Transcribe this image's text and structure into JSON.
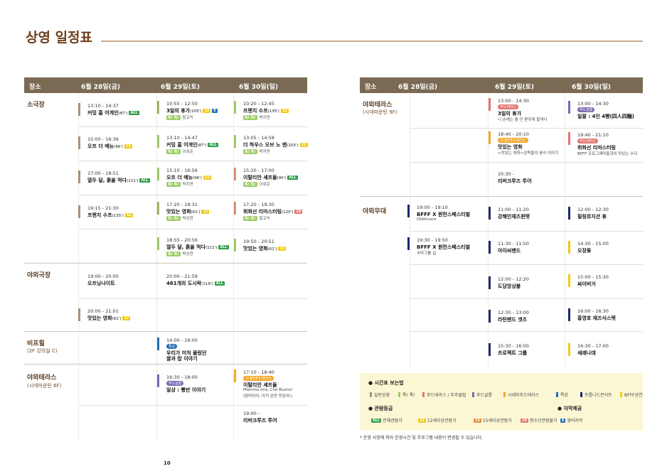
{
  "page": {
    "title": "상영 일정표",
    "number": "10",
    "note": "* 운영 사정에 따라 운영시간 및 프로그램 내용이 변경될 수 있습니다."
  },
  "colors": {
    "header": "#7a6a54",
    "general": "#a8927a",
    "talk": "#9ccc65",
    "food": "#e57373",
    "food_salon": "#7b68b3",
    "cinema_food": "#f5a623",
    "special": "#1e6fb5",
    "frontier": "#1a2a6b",
    "bfff": "#f2c812"
  },
  "left": {
    "headers": [
      "장소",
      "6월 28일(금)",
      "6월 29일(토)",
      "6월 30일(일)"
    ],
    "venues": [
      {
        "name": "소극장",
        "sub": ""
      },
      {
        "name": "야외극장",
        "sub": ""
      },
      {
        "name": "비프힐",
        "sub": "(2F 강의실 C)"
      },
      {
        "name": "야외테라스",
        "sub": "(시네마운틴 6F)"
      }
    ],
    "events": [
      {
        "time": "13:10 - 14:37",
        "name": "커밍 홈 어게인",
        "dur": "(87')",
        "rate": "ALL",
        "rc": "#2e9e48",
        "people": "",
        "bar": "#a8927a"
      },
      {
        "time": "15:00 - 16:36",
        "name": "오프 더 메뉴",
        "dur": "(96')",
        "rate": "12",
        "rc": "#f2c812",
        "people": "",
        "bar": "#a8927a"
      },
      {
        "time": "17:00 - 18:51",
        "name": "열두 달, 흙을 먹다",
        "dur": "(111')",
        "rate": "ALL",
        "rc": "#2e9e48",
        "people": "",
        "bar": "#a8927a"
      },
      {
        "time": "19:15 - 21:30",
        "name": "프렌치 수프",
        "dur": "(135')",
        "rate": "12",
        "rc": "#f2c812",
        "people": "",
        "bar": "#a8927a"
      },
      {
        "time": "10:55 - 12:50",
        "name": "3일의 휴가",
        "dur": "(105')",
        "rate": "12",
        "rc": "#f2c812",
        "rate2": "E",
        "people": "황교익",
        "bar": "split"
      },
      {
        "time": "13:10 - 14:47",
        "name": "커밍 홈 어게인",
        "dur": "(87')",
        "rate": "ALL",
        "rc": "#2e9e48",
        "people": "이호준",
        "bar": "#9ccc65"
      },
      {
        "time": "15:10 - 16:56",
        "name": "오프 더 메뉴",
        "dur": "(96')",
        "rate": "12",
        "rc": "#f2c812",
        "people": "박지연",
        "bar": "#9ccc65"
      },
      {
        "time": "17:20 - 18:31",
        "name": "맛있는 영화",
        "dur": "(61')",
        "rate": "12",
        "rc": "#f2c812",
        "people": "박상현",
        "bar": "split"
      },
      {
        "time": "18:55 - 20:56",
        "name": "열두 달, 흙을 먹다",
        "dur": "(111')",
        "rate": "ALL",
        "rc": "#2e9e48",
        "people": "박상현",
        "bar": "#9ccc65"
      },
      {
        "time": "10:20 - 12:45",
        "name": "프렌치 수프",
        "dur": "(135')",
        "rate": "12",
        "rc": "#f2c812",
        "people": "박지연",
        "bar": "#9ccc65"
      },
      {
        "time": "13:05 - 14:58",
        "name": "더 하우스 오브 노 맨",
        "dur": "(103')",
        "rate": "12",
        "rc": "#f2c812",
        "people": "박지연",
        "bar": "#9ccc65"
      },
      {
        "time": "15:20 - 17:00",
        "name": "이탈리안 셰프들",
        "dur": "(90')",
        "rate": "ALL",
        "rc": "#2e9e48",
        "people": "이호준",
        "bar": "split"
      },
      {
        "time": "17:20 - 19:30",
        "name": "취화선 리마스터링",
        "dur": "(120')",
        "rate": "18",
        "rc": "#e57373",
        "people": "황교익",
        "bar": "split"
      },
      {
        "time": "19:50 - 20:51",
        "name": "맛있는 영화",
        "dur": "(61')",
        "rate": "12",
        "rc": "#f2c812",
        "people": "",
        "bar": "#9ccc65"
      },
      {
        "time": "19:00 - 20:00",
        "name": "오프닝나이트",
        "dur": "",
        "rate": "",
        "people": "",
        "bar": ""
      },
      {
        "time": "20:00 - 21:01",
        "name": "맛있는 영화",
        "dur": "(61')",
        "rate": "12",
        "rc": "#f2c812",
        "people": "",
        "bar": "#a8927a"
      },
      {
        "time": "20:00 - 21:59",
        "name": "461개의 도시락",
        "dur": "(119')",
        "rate": "ALL",
        "rc": "#2e9e48",
        "people": "",
        "bar": ""
      },
      {
        "time": "14:00 - 16:00",
        "name": "우리가 미처 몰랐던",
        "name2": "쌀과 밥 이야기",
        "tag": "특강",
        "tc": "#1e6fb5",
        "bar": "#1e6fb5"
      },
      {
        "time": "16:30 - 18:00",
        "name": "일상 : 빵반 이야기",
        "tag": "푸드살롱",
        "tc": "#7b68b3",
        "bar": "#7b68b3"
      },
      {
        "time": "17:10 - 18:40",
        "name": "이탈리안 셰프들",
        "d1": "Mamma mia, Che Buono!",
        "d2": "(맘마미아, 이거 완전 맛있어!)",
        "tag": "시네마푸드테라스",
        "tc": "#f5a623",
        "bar": "#f5a623"
      },
      {
        "time": "19:00 -",
        "name": "리버크루즈 투어",
        "bar": ""
      }
    ],
    "talk_label": "톡! 톡!"
  },
  "right": {
    "headers": [
      "장소",
      "6월 28일(금)",
      "6월 29일(토)",
      "6월 30일(일)"
    ],
    "venues": [
      {
        "name": "야외테라스",
        "sub": "(시네마운틴 9F)"
      },
      {
        "name": "야외무대",
        "sub": ""
      }
    ],
    "terrace": [
      {
        "time": "13:00 - 14:30",
        "tag": "푸드테라스",
        "tc": "#e57373",
        "name": "3일의 휴가",
        "d": "니 손에는 뭘 안 묻히게 할꺼다",
        "bar": "#e57373"
      },
      {
        "time": "18:40 - 20:10",
        "tag": "시네마푸드테라스",
        "tc": "#f5a623",
        "name": "맛있는 영화",
        "d": "<맛있는 영화>감독들의 음식 이야기",
        "bar": "#f5a623"
      },
      {
        "time": "20:30 -",
        "name": "리버크루즈 투어",
        "bar": ""
      },
      {
        "time": "13:00 - 14:30",
        "tag": "푸드살롱",
        "tc": "#7b68b3",
        "name": "일팔 : 4인 4빵(四人四麵)",
        "bar": "#7b68b3"
      },
      {
        "time": "19:40 - 21:10",
        "tag": "푸드테라스",
        "tc": "#e57373",
        "name": "취화선 리마스터링",
        "d": "BFFF 프로그래머들과의 맛있는 수다",
        "bar": "#e57373"
      }
    ],
    "stage": [
      {
        "time": "19:00 - 19:10",
        "name": "BFFF X 원먼스페스티벌",
        "d": "Obblivoce",
        "bar": "#1a2a6b"
      },
      {
        "time": "19:30 - 19:50",
        "name": "BFFF X 원먼스페스티벌",
        "d": "국악그룹 길",
        "bar": "#1a2a6b"
      },
      {
        "time": "11:00 - 11:20",
        "name": "강해인재즈퀸텟",
        "bar": "#1a2a6b"
      },
      {
        "time": "11:30 - 11:50",
        "name": "아이씨밴드",
        "bar": "#1a2a6b"
      },
      {
        "time": "12:00 - 12:20",
        "name": "도담앙상블",
        "bar": "#1a2a6b"
      },
      {
        "time": "12:30 - 13:00",
        "name": "라틴밴드 겟츠",
        "bar": "#1a2a6b"
      },
      {
        "time": "15:30 - 16:00",
        "name": "프로젝트 그룹",
        "bar": "#1a2a6b"
      },
      {
        "time": "12:00 - 12:30",
        "name": "필링뮤지션 휴",
        "bar": "#1a2a6b"
      },
      {
        "time": "14:30 - 15:00",
        "name": "오장윷",
        "bar": "#f2c812"
      },
      {
        "time": "15:00 - 15:30",
        "name": "싸이버거",
        "bar": "#f2c812"
      },
      {
        "time": "16:00 - 16:30",
        "name": "홍영호 재즈식스텟",
        "bar": "#1a2a6b"
      },
      {
        "time": "16:30 - 17:00",
        "name": "세레나데",
        "bar": "#f2c812"
      }
    ]
  },
  "legend": {
    "h1": "시간표 보는법",
    "items": [
      "일반상영",
      "톡! 톡!",
      "푸드테라스 / 주주클럽",
      "푸드살롱",
      "시네마푸드테라스",
      "특강",
      "프롱니드콘서트",
      "BFFF공연"
    ],
    "h2": "관람등급",
    "ratings": [
      "전체관람가",
      "12세이상관람가",
      "15세이상관람가",
      "청소년관람불가"
    ],
    "h3": "자막제공",
    "subtitle": "영어자막"
  }
}
